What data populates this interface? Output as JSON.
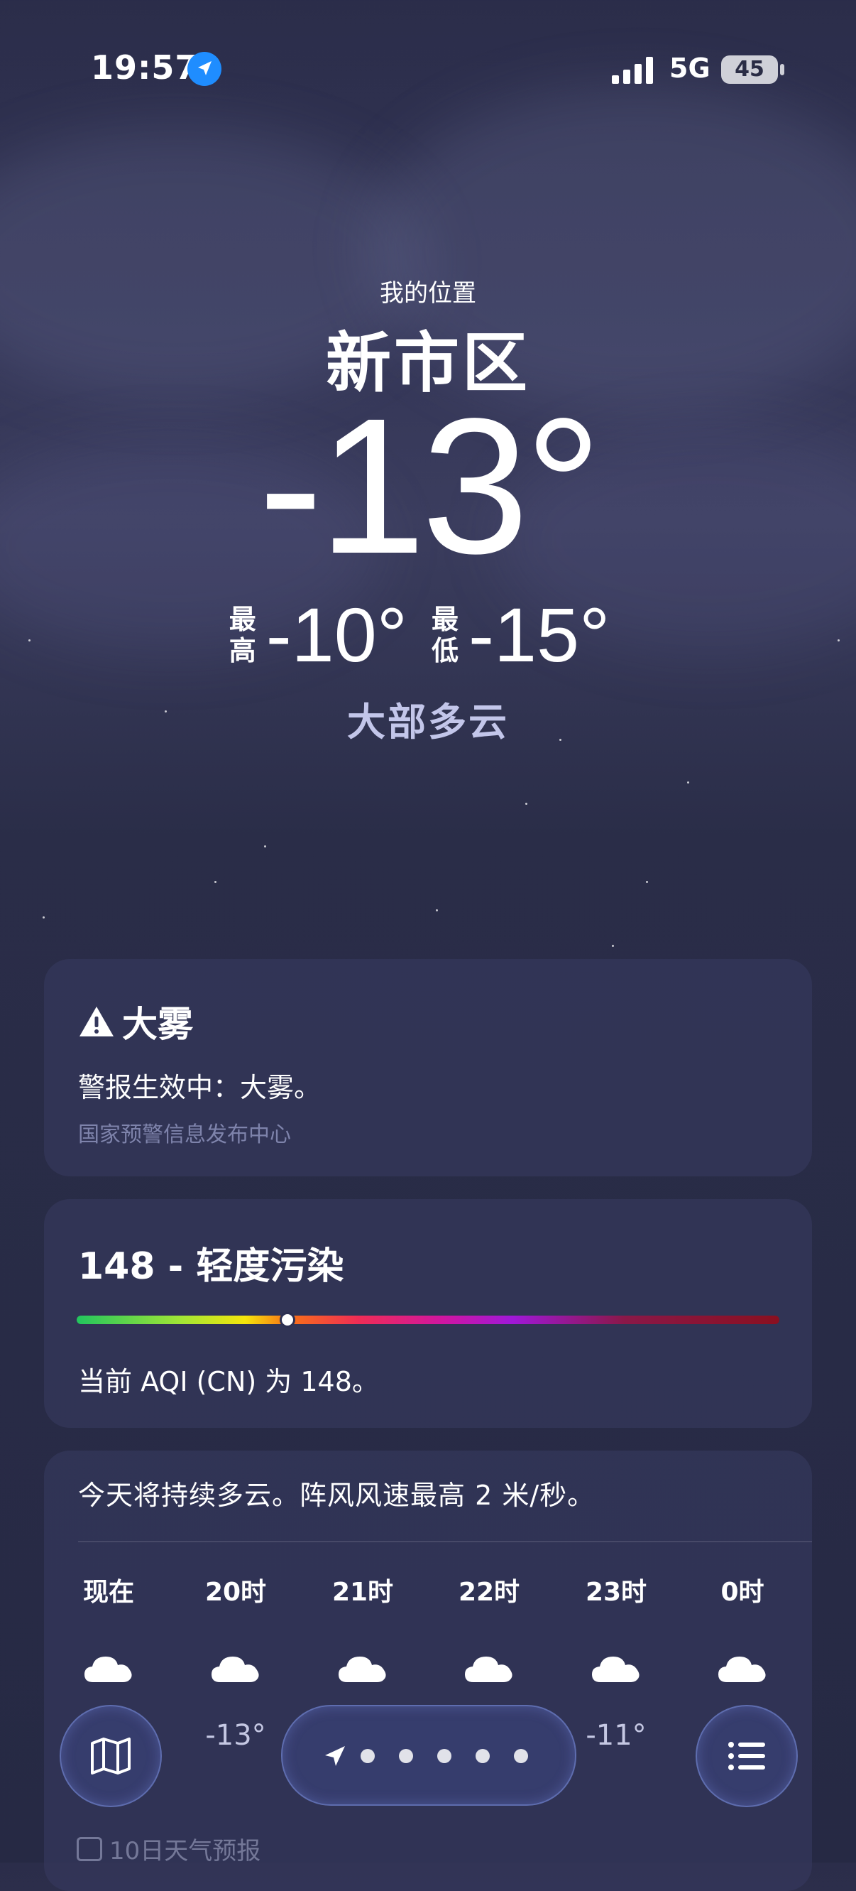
{
  "status_bar": {
    "time": "19:57",
    "network": "5G",
    "battery": "45",
    "location_icon": "location-arrow-icon"
  },
  "header": {
    "subtitle": "我的位置",
    "city": "新市区",
    "temperature": "-13°",
    "high_label": "最高",
    "high": "-10°",
    "low_label": "最低",
    "low": "-15°",
    "condition": "大部多云"
  },
  "alert": {
    "title": "大雾",
    "text": "警报生效中：大雾。",
    "source": "国家预警信息发布中心",
    "icon": "warning-triangle-icon"
  },
  "aqi": {
    "title": "148 - 轻度污染",
    "text": "当前 AQI (CN) 为 148。",
    "value": 148,
    "position_fraction": 0.3,
    "colors": [
      "#22c55e",
      "#f5e50b",
      "#f97316",
      "#ef2d55",
      "#a018d8",
      "#8a1020"
    ]
  },
  "hourly": {
    "summary": "今天将持续多云。阵风风速最高 2 米/秒。",
    "items": [
      {
        "label": "现在",
        "icon": "cloud-icon",
        "temp": ""
      },
      {
        "label": "20时",
        "icon": "cloud-icon",
        "temp": "-13°"
      },
      {
        "label": "21时",
        "icon": "cloud-icon",
        "temp": ""
      },
      {
        "label": "22时",
        "icon": "cloud-icon",
        "temp": ""
      },
      {
        "label": "23时",
        "icon": "cloud-icon",
        "temp": "-11°"
      },
      {
        "label": "0时",
        "icon": "cloud-icon",
        "temp": ""
      }
    ]
  },
  "forecast_link": {
    "label": "10日天气预报",
    "icon": "calendar-icon"
  },
  "toolbar": {
    "map_icon": "map-icon",
    "list_icon": "list-icon",
    "page_indicator_icon": "location-arrow-icon"
  },
  "colors": {
    "background": "#2b2d4a",
    "card": "#34375c",
    "accent_blue": "#1f8dff",
    "condition_text": "#c3c6ea"
  }
}
